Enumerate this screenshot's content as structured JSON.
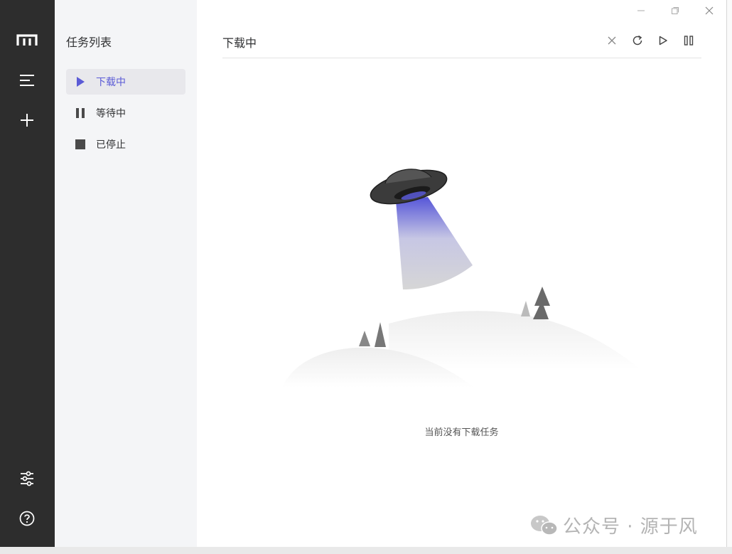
{
  "sidebar_title": "任务列表",
  "task_items": [
    {
      "label": "下载中",
      "icon": "play-icon",
      "active": true
    },
    {
      "label": "等待中",
      "icon": "pause-icon",
      "active": false
    },
    {
      "label": "已停止",
      "icon": "stop-icon",
      "active": false
    }
  ],
  "main": {
    "title": "下载中",
    "empty_text": "当前没有下载任务"
  },
  "rail_icons": [
    "logo-icon",
    "menu-icon",
    "add-icon",
    "settings-icon",
    "help-icon"
  ],
  "header_actions": [
    "close-icon",
    "refresh-icon",
    "resume-all-icon",
    "pause-all-icon"
  ],
  "window_controls": [
    "minimize-icon",
    "maximize-icon",
    "close-window-icon"
  ],
  "watermark": {
    "text": "公众号 · 源于风"
  },
  "colors": {
    "rail_bg": "#2d2d2d",
    "aside_bg": "#f4f5f7",
    "accent": "#5b5bd6"
  }
}
